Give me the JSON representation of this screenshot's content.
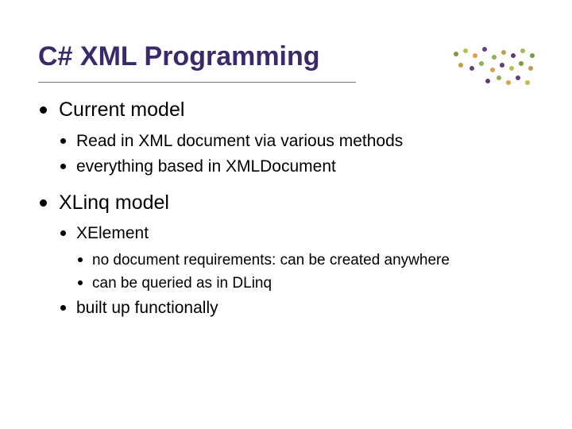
{
  "title": "C# XML Programming",
  "bullets": {
    "b1": {
      "label": "Current model",
      "c1": "Read in XML document via various methods",
      "c2": "everything based in XMLDocument"
    },
    "b2": {
      "label": "XLinq model",
      "c1": {
        "label": "XElement",
        "d1": "no document requirements: can be created anywhere",
        "d2": "can be queried as in DLinq"
      },
      "c2": "built up functionally"
    }
  }
}
